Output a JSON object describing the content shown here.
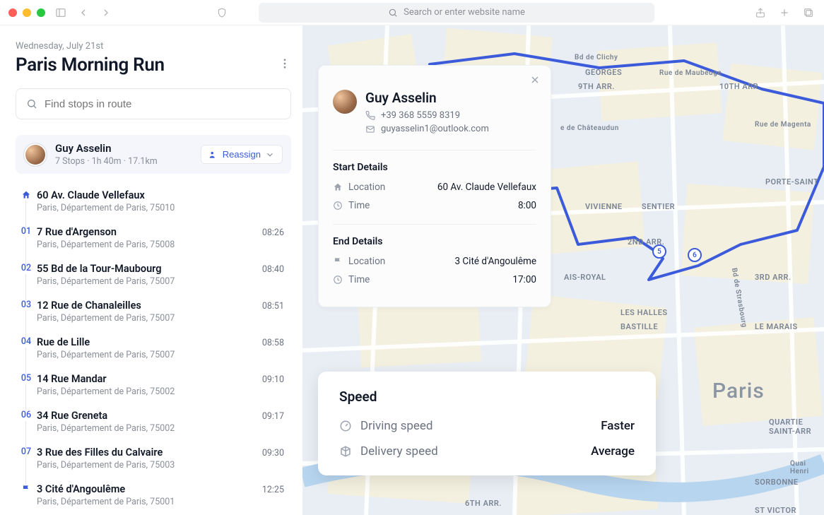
{
  "chrome": {
    "url_placeholder": "Search or enter website name"
  },
  "sidebar": {
    "date": "Wednesday, July 21st",
    "title": "Paris Morning Run",
    "search_placeholder": "Find stops in route",
    "driver": {
      "name": "Guy Asselin",
      "stops_summary": "7 Stops · 1h 40m · 17.1km"
    },
    "reassign_label": "Reassign",
    "start_stop": {
      "address": "60 Av. Claude Vellefaux",
      "subaddress": "Paris, Département de Paris, 75010"
    },
    "stops": [
      {
        "num": "01",
        "address": "7 Rue d'Argenson",
        "subaddress": "Paris, Département de Paris, 75008",
        "time": "08:26"
      },
      {
        "num": "02",
        "address": "55 Bd de la Tour-Maubourg",
        "subaddress": "Paris, Département de Paris, 75007",
        "time": "08:40"
      },
      {
        "num": "03",
        "address": "12 Rue de Chanaleilles",
        "subaddress": "Paris, Département de Paris, 75007",
        "time": "08:51"
      },
      {
        "num": "04",
        "address": "Rue de Lille",
        "subaddress": "Paris, Département de Paris, 75007",
        "time": "08:58"
      },
      {
        "num": "05",
        "address": "14 Rue Mandar",
        "subaddress": "Paris, Département de Paris, 75002",
        "time": "09:10"
      },
      {
        "num": "06",
        "address": "34 Rue Greneta",
        "subaddress": "Paris, Département de Paris, 75002",
        "time": "09:17"
      },
      {
        "num": "07",
        "address": "3 Rue des Filles du Calvaire",
        "subaddress": "Paris, Département de Paris, 75003",
        "time": "09:30"
      }
    ],
    "end_stop": {
      "address": "3 Cité d'Angoulême",
      "subaddress": "Paris, Département de Paris, 75001",
      "time": "12:25"
    }
  },
  "panel": {
    "name": "Guy Asselin",
    "phone": "+39 368 5559 8319",
    "email": "guyasselin1@outlook.com",
    "start_heading": "Start Details",
    "end_heading": "End Details",
    "labels": {
      "location": "Location",
      "time": "Time"
    },
    "start": {
      "location": "60 Av. Claude Vellefaux",
      "time": "8:00"
    },
    "end": {
      "location": "3 Cité d'Angoulême",
      "time": "17:00"
    }
  },
  "speed": {
    "title": "Speed",
    "driving_label": "Driving speed",
    "driving_value": "Faster",
    "delivery_label": "Delivery speed",
    "delivery_value": "Average"
  },
  "map": {
    "pins": [
      "5",
      "6"
    ],
    "city_label": "Paris",
    "districts": [
      "GEORGES",
      "9TH ARR.",
      "10TH ARR.",
      "VIVIENNE",
      "SENTIER",
      "PORTE-SAINT",
      "2ND ARR.",
      "AIS-ROYAL",
      "3RD ARR.",
      "LES HALLES",
      "BASTILLE",
      "LE MARAIS",
      "6TH ARR.",
      "SORBONNE",
      "ST VICTOR",
      "QUARTIE SAINT-ARR",
      "Rue de Maubeuge",
      "Rue de Magenta",
      "e de Châteaudun",
      "Bd de Clichy",
      "Bd de Strasbourg",
      "Quai Henri"
    ]
  }
}
